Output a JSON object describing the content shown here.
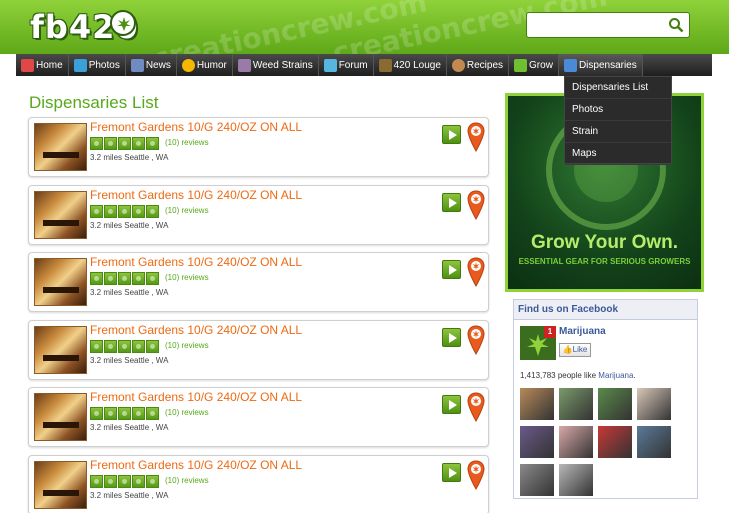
{
  "header": {
    "logo_text": "fb420",
    "watermark": "creationcrew.com",
    "search": {
      "value": "",
      "placeholder": ""
    }
  },
  "nav": {
    "items": [
      {
        "label": "Home",
        "icon": "home-icon",
        "color": "#e04848"
      },
      {
        "label": "Photos",
        "icon": "photos-icon",
        "color": "#3ba0d8"
      },
      {
        "label": "News",
        "icon": "news-icon",
        "color": "#6f8bc2"
      },
      {
        "label": "Humor",
        "icon": "humor-icon",
        "color": "#f5b800"
      },
      {
        "label": "Weed Strains",
        "icon": "strains-icon",
        "color": "#9a7aa8"
      },
      {
        "label": "Forum",
        "icon": "forum-icon",
        "color": "#56b6e0"
      },
      {
        "label": "420 Louge",
        "icon": "lounge-icon",
        "color": "#8a6a30"
      },
      {
        "label": "Recipes",
        "icon": "recipes-icon",
        "color": "#c08a50"
      },
      {
        "label": "Grow",
        "icon": "grow-icon",
        "color": "#6fc030"
      },
      {
        "label": "Dispensaries",
        "icon": "dispensaries-icon",
        "color": "#4a8ad8"
      }
    ],
    "dropdown": [
      "Dispensaries List",
      "Photos",
      "Strain",
      "Maps"
    ]
  },
  "main": {
    "title": "Dispensaries List",
    "listings": [
      {
        "name": "Fremont Gardens 10/G 240/OZ ON ALL",
        "rating": 5,
        "reviews": "(10) reviews",
        "location": "3.2 miles Seattle , WA"
      },
      {
        "name": "Fremont Gardens 10/G 240/OZ ON ALL",
        "rating": 5,
        "reviews": "(10) reviews",
        "location": "3.2 miles Seattle , WA"
      },
      {
        "name": "Fremont Gardens 10/G 240/OZ ON ALL",
        "rating": 5,
        "reviews": "(10) reviews",
        "location": "3.2 miles Seattle , WA"
      },
      {
        "name": "Fremont Gardens 10/G 240/OZ ON ALL",
        "rating": 5,
        "reviews": "(10) reviews",
        "location": "3.2 miles Seattle , WA"
      },
      {
        "name": "Fremont Gardens 10/G 240/OZ ON ALL",
        "rating": 5,
        "reviews": "(10) reviews",
        "location": "3.2 miles Seattle , WA"
      },
      {
        "name": "Fremont Gardens 10/G 240/OZ ON ALL",
        "rating": 5,
        "reviews": "(10) reviews",
        "location": "3.2 miles Seattle , WA"
      }
    ]
  },
  "ad": {
    "title": "Grow Your Own.",
    "subtitle": "ESSENTIAL GEAR FOR SERIOUS GROWERS"
  },
  "facebook": {
    "header": "Find us on Facebook",
    "page_name": "Marijuana",
    "badge": "1",
    "like_label": "Like",
    "count_prefix": "1,413,783 people like ",
    "count_page": "Marijuana",
    "count_suffix": ".",
    "faces": [
      "#b88a5a",
      "#7a9a6a",
      "#5a8a4a",
      "#d8c8b8",
      "#6a5a8a",
      "#d8a8a8",
      "#c83838",
      "#5a7a9a",
      "#8a8a8a",
      "#b8b8b8"
    ]
  },
  "colors": {
    "brand_green": "#8fd23a",
    "title_green": "#58a81b",
    "listing_orange": "#ee6a12",
    "nav_dark": "#1e1e1e",
    "facebook_blue": "#3b5998"
  }
}
